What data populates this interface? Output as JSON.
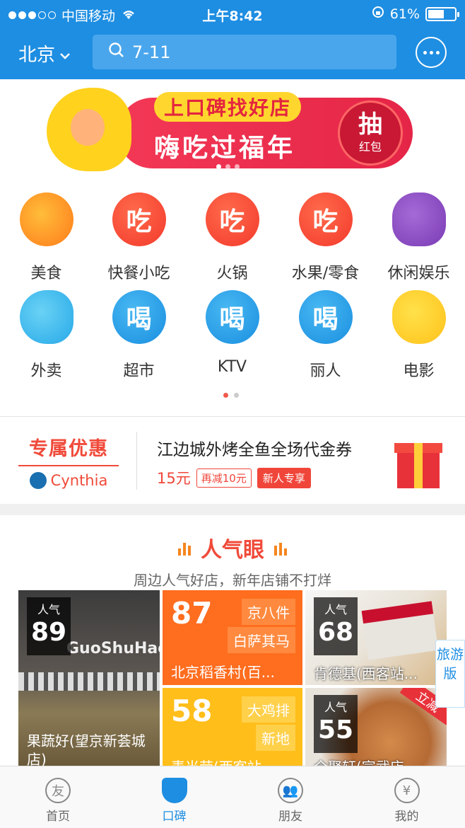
{
  "status": {
    "carrier": "中国移动",
    "time": "上午8:42",
    "battery": "61%",
    "battery_level": 0.61
  },
  "header": {
    "city": "北京",
    "search_value": "7-11"
  },
  "banner": {
    "tag": "上口碑找好店",
    "slogan": "嗨吃过福年",
    "draw_main": "抽",
    "draw_sub": "红包"
  },
  "categories": [
    {
      "label": "美食",
      "glyph": "",
      "color": "orange"
    },
    {
      "label": "快餐小吃",
      "glyph": "吃",
      "color": "red"
    },
    {
      "label": "火锅",
      "glyph": "吃",
      "color": "red"
    },
    {
      "label": "水果/零食",
      "glyph": "吃",
      "color": "red"
    },
    {
      "label": "休闲娱乐",
      "glyph": "",
      "color": "purple"
    },
    {
      "label": "外卖",
      "glyph": "",
      "color": "cyan"
    },
    {
      "label": "超市",
      "glyph": "喝",
      "color": "blue"
    },
    {
      "label": "KTV",
      "glyph": "喝",
      "color": "blue"
    },
    {
      "label": "丽人",
      "glyph": "喝",
      "color": "blue"
    },
    {
      "label": "电影",
      "glyph": "",
      "color": "yellow"
    }
  ],
  "promo": {
    "brand": "专属优惠",
    "user": "Cynthia",
    "title": "江边城外烤全鱼全场代金券",
    "price": "15元",
    "discount": "再减10元",
    "new_user": "新人专享"
  },
  "hot": {
    "title": "人气眼",
    "subtitle": "周边人气好店，新年店铺不打烊"
  },
  "tiles": {
    "t1": {
      "label": "人气",
      "score": "89",
      "name": "果蔬好(望京新荟城店)",
      "sign": "GuoShuHao"
    },
    "t2": {
      "score": "87",
      "tag1": "京八件",
      "tag2": "白萨其马",
      "name": "北京稻香村(百..."
    },
    "t3": {
      "label": "人气",
      "score": "68",
      "name": "肯德基(西客站..."
    },
    "t4": {
      "score": "58",
      "tag1": "大鸡排",
      "tag2": "新地",
      "name": "麦当劳(西客站..."
    },
    "t5": {
      "label": "人气",
      "score": "55",
      "corner": "立减",
      "name": "全聚轩(宣武店..."
    }
  },
  "side": {
    "text": "旅游版"
  },
  "tabs": [
    {
      "label": "首页",
      "icon": "友"
    },
    {
      "label": "口碑",
      "icon": ""
    },
    {
      "label": "朋友",
      "icon": "👥"
    },
    {
      "label": "我的",
      "icon": "¥"
    }
  ]
}
